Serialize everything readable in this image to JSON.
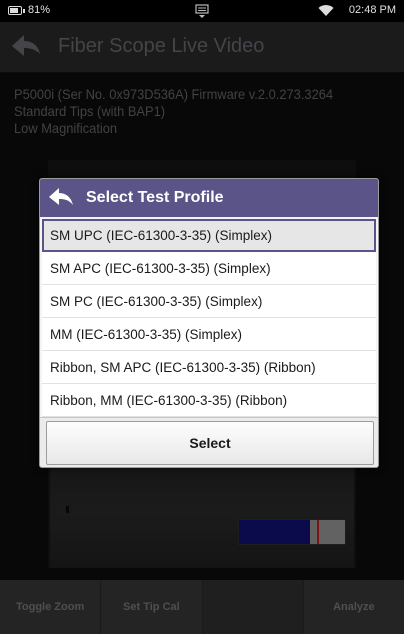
{
  "status_bar": {
    "battery_percent": "81%",
    "battery_level": 0.81,
    "time": "02:48 PM",
    "icons": [
      "battery-icon",
      "notification-icon",
      "wifi-icon"
    ]
  },
  "title_bar": {
    "title": "Fiber Scope Live Video",
    "back_icon": "back-arrow-icon"
  },
  "info": {
    "line1": "P5000i (Ser No. 0x973D536A) Firmware v.2.0.273.3264",
    "line2": "Standard Tips (with BAP1)",
    "line3": "Low Magnification"
  },
  "video": {
    "level_fill_fraction": 0.67,
    "level_marker_fraction": 0.74,
    "colors": {
      "fill": "#10106a",
      "marker": "#b01a1a",
      "rest": "#888888"
    }
  },
  "dialog": {
    "title": "Select Test Profile",
    "back_icon": "back-arrow-icon",
    "selected_index": 0,
    "items": [
      {
        "label": "SM UPC (IEC-61300-3-35) (Simplex)"
      },
      {
        "label": "SM APC (IEC-61300-3-35) (Simplex)"
      },
      {
        "label": "SM PC (IEC-61300-3-35) (Simplex)"
      },
      {
        "label": "MM (IEC-61300-3-35) (Simplex)"
      },
      {
        "label": "Ribbon, SM APC (IEC-61300-3-35) (Ribbon)"
      },
      {
        "label": "Ribbon, MM (IEC-61300-3-35) (Ribbon)"
      }
    ],
    "select_label": "Select",
    "header_color": "#5a5488"
  },
  "toolbar": {
    "toggle_zoom": "Toggle Zoom",
    "set_tip_cal": "Set Tip Cal",
    "blank": "",
    "analyze": "Analyze"
  }
}
